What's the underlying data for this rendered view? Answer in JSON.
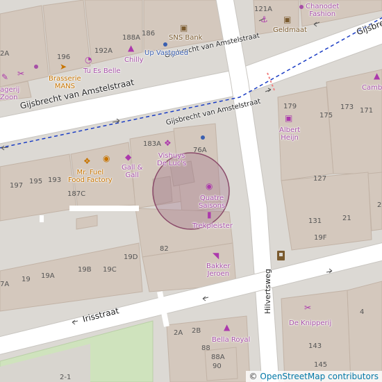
{
  "streets": {
    "gijsbrecht_1": "Gijsbrecht van Amstelstraat",
    "gijsbrecht_2": "Gijsbrecht van Amstelstraat",
    "gijsbrecht_3": "Gijsbrecht van Amstelstraat",
    "gijsbrecht_4": "Gijsbre",
    "hilvertsweg": "Hilvertsweg",
    "irisstraat": "Irisstraat"
  },
  "pois": {
    "chanodet": "Chanodet\nFashion",
    "geldmaat": "Geldmaat",
    "sns_bank": "SNS Bank",
    "up_vastgoed": "Up Vastgoed",
    "chilly": "Chilly",
    "tu_es_belle": "Tu Es Belle",
    "brasserie_mans": "Brasserie\nMANS",
    "gerij": "agerij\nZoon",
    "vishuys": "Vishuys\nDe Luc's",
    "gall_gall": "Gall &\nGall",
    "mr_fuel": "Mr. Fuel\nFood Factory",
    "quatre_saisons": "Quatre\nSaisons",
    "trekpleister": "Trekpleister",
    "bakker_jeroen": "Bakker\nJeroen",
    "albert_heijn": "Albert\nHeijn",
    "cambi": "Camb",
    "de_knipperij": "De Knipperij",
    "bella_royal": "Bella Royal"
  },
  "house_numbers": {
    "n121a": "121A",
    "n188a": "188A",
    "n186": "186",
    "n196": "196",
    "n192a": "192A",
    "n2a": "2A",
    "n183a": "183A",
    "n76a": "76A",
    "n197": "197",
    "n195": "195",
    "n193": "193",
    "n187c": "187C",
    "n82": "82",
    "n19b": "19B",
    "n19c": "19C",
    "n19d": "19D",
    "n7a": "7A",
    "n19": "19",
    "n19a": "19A",
    "n179": "179",
    "n175": "175",
    "n173": "173",
    "n171": "171",
    "n127": "127",
    "n131": "131",
    "n21": "21",
    "n19f": "19F",
    "n4": "4",
    "n143": "143",
    "n145": "145",
    "n2a_b": "2A",
    "n2b": "2B",
    "n88": "88",
    "n88a": "88A",
    "n90": "90",
    "n2_1": "2-1",
    "n2": "2"
  },
  "attribution": {
    "symbol": "©",
    "text": "OpenStreetMap contributors"
  },
  "colors": {
    "land": "#dcd9d4",
    "building": "#d4c8bd",
    "road": "#ffffff",
    "bus_route": "#1a3cc4",
    "poi_shop": "#ac39ac",
    "poi_food": "#c77400",
    "highlight_circle": "#a0728a",
    "grass": "#cfe3bd"
  }
}
